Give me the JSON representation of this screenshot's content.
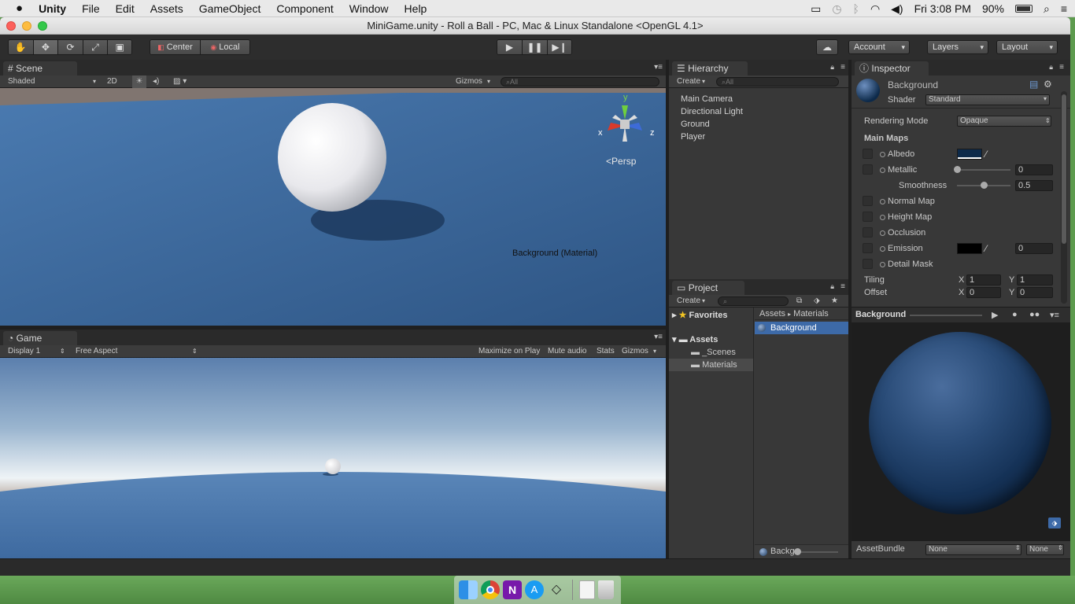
{
  "menubar": {
    "app": "Unity",
    "items": [
      "File",
      "Edit",
      "Assets",
      "GameObject",
      "Component",
      "Window",
      "Help"
    ],
    "clock": "Fri 3:08 PM",
    "battery": "90%"
  },
  "window": {
    "title": "MiniGame.unity - Roll a Ball - PC, Mac & Linux Standalone <OpenGL 4.1>"
  },
  "toolbar": {
    "pivot": "Center",
    "space": "Local",
    "account": "Account",
    "layers": "Layers",
    "layout": "Layout"
  },
  "scene": {
    "tab": "Scene",
    "shading": "Shaded",
    "mode2d": "2D",
    "gizmos": "Gizmos",
    "search_placeholder": "All",
    "axis_x": "x",
    "axis_y": "y",
    "axis_z": "z",
    "persp": "Persp",
    "overlay_label": "Background (Material)"
  },
  "game": {
    "tab": "Game",
    "display": "Display 1",
    "aspect": "Free Aspect",
    "maximize": "Maximize on Play",
    "mute": "Mute audio",
    "stats": "Stats",
    "gizmos": "Gizmos"
  },
  "hierarchy": {
    "tab": "Hierarchy",
    "create": "Create",
    "search_placeholder": "All",
    "items": [
      "Main Camera",
      "Directional Light",
      "Ground",
      "Player"
    ]
  },
  "project": {
    "tab": "Project",
    "create": "Create",
    "favorites": "Favorites",
    "assets": "Assets",
    "folders": [
      "_Scenes",
      "Materials"
    ],
    "breadcrumb": [
      "Assets",
      "Materials"
    ],
    "selected_asset": "Background",
    "footer_item": "Backg"
  },
  "inspector": {
    "tab": "Inspector",
    "object_name": "Background",
    "shader_label": "Shader",
    "shader_value": "Standard",
    "rendering_mode_label": "Rendering Mode",
    "rendering_mode_value": "Opaque",
    "main_maps": "Main Maps",
    "albedo": "Albedo",
    "metallic": "Metallic",
    "metallic_value": "0",
    "metallic_level": 0,
    "smoothness": "Smoothness",
    "smoothness_value": "0.5",
    "smoothness_level": 0.5,
    "normal_map": "Normal Map",
    "height_map": "Height Map",
    "occlusion": "Occlusion",
    "emission": "Emission",
    "emission_value": "0",
    "detail_mask": "Detail Mask",
    "tiling": "Tiling",
    "offset": "Offset",
    "tiling_x": "1",
    "tiling_y": "1",
    "offset_x": "0",
    "offset_y": "0",
    "label_x": "X",
    "label_y": "Y",
    "preview_title": "Background",
    "assetbundle_label": "AssetBundle",
    "assetbundle_value": "None",
    "assetbundle_variant": "None"
  },
  "colors": {
    "albedo": "#0d2a4a",
    "emission": "#000000",
    "ground": "#3e6fa6",
    "selection": "#3d6aa8"
  }
}
